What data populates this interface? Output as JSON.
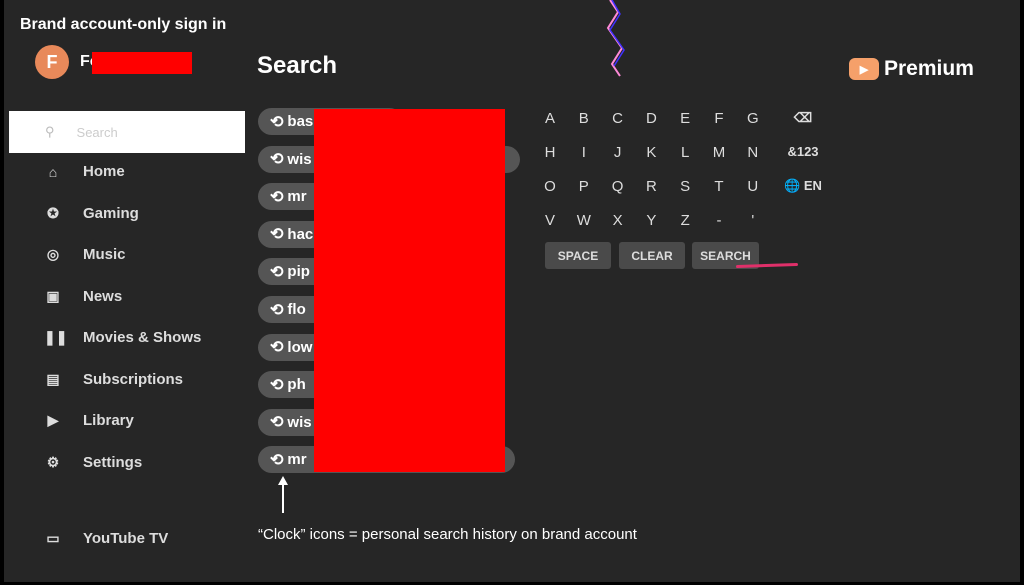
{
  "annotation": {
    "caption": "Brand account-only sign in",
    "note": "“Clock” icons = personal search history on brand account"
  },
  "account": {
    "initial": "F",
    "name_visible": "Fo"
  },
  "sidebar": {
    "search_placeholder": "Search",
    "items": [
      {
        "label": "Home",
        "icon": "home-icon",
        "glyph": "⌂"
      },
      {
        "label": "Gaming",
        "icon": "gaming-icon",
        "glyph": "✪"
      },
      {
        "label": "Music",
        "icon": "music-icon",
        "glyph": "◎"
      },
      {
        "label": "News",
        "icon": "news-icon",
        "glyph": "▣"
      },
      {
        "label": "Movies & Shows",
        "icon": "movies-icon",
        "glyph": "❚❚"
      },
      {
        "label": "Subscriptions",
        "icon": "subscriptions-icon",
        "glyph": "▤"
      },
      {
        "label": "Library",
        "icon": "library-icon",
        "glyph": "▶"
      },
      {
        "label": "Settings",
        "icon": "settings-icon",
        "glyph": "⚙"
      }
    ],
    "youtube_tv": {
      "label": "YouTube TV",
      "glyph": "▭"
    }
  },
  "main": {
    "title": "Search",
    "brand": "Premium",
    "history": [
      "bas",
      "wis",
      "mr",
      "hac",
      "pip",
      "flo",
      "low",
      "ph",
      "wis",
      "mr"
    ],
    "keyboard": {
      "rows": [
        [
          "A",
          "B",
          "C",
          "D",
          "E",
          "F",
          "G",
          "⌫"
        ],
        [
          "H",
          "I",
          "J",
          "K",
          "L",
          "M",
          "N",
          "&123"
        ],
        [
          "O",
          "P",
          "Q",
          "R",
          "S",
          "T",
          "U",
          "🌐 EN"
        ],
        [
          "V",
          "W",
          "X",
          "Y",
          "Z",
          "-",
          "'"
        ]
      ],
      "space": "SPACE",
      "clear": "CLEAR",
      "search": "SEARCH"
    }
  },
  "colors": {
    "accent": "#ff0000",
    "avatar": "#e8895a"
  }
}
